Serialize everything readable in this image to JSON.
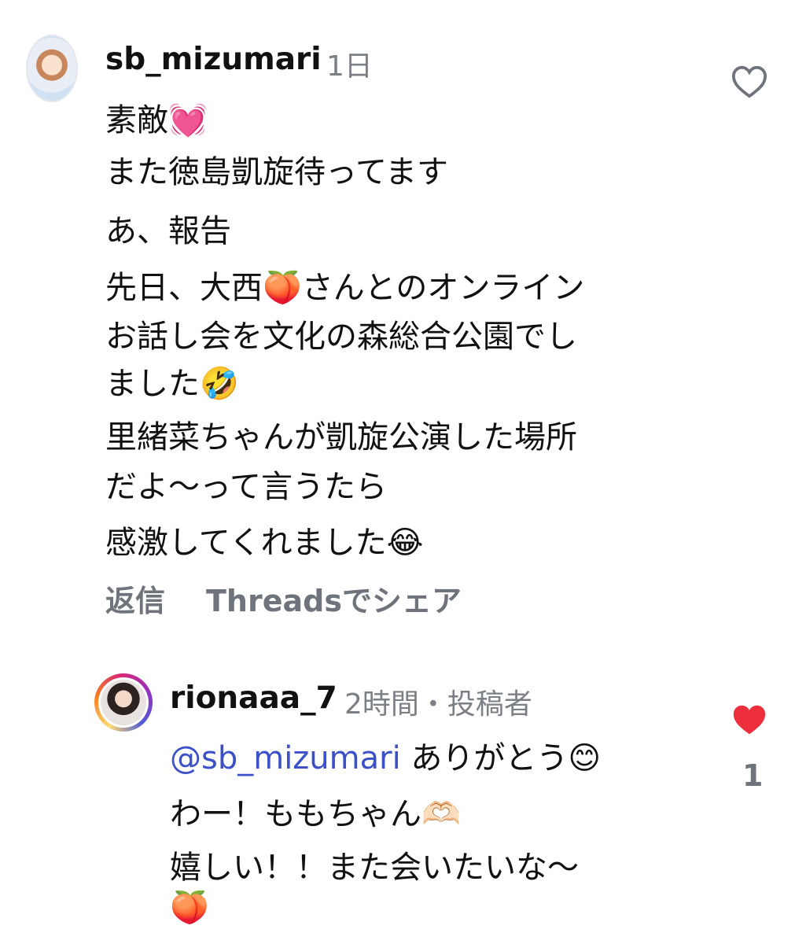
{
  "comment": {
    "username": "sb_mizumari",
    "time": "1日",
    "lines": [
      "素敵💓",
      "また徳島凱旋待ってます",
      "あ、報告",
      "先日、大西🍑さんとのオンライン",
      "お話し会を文化の森総合公園でし",
      "ました🤣",
      "里緒菜ちゃんが凱旋公演した場所",
      "だよ〜って言うたら",
      "感激してくれました😂"
    ],
    "actions": {
      "reply": "返信",
      "share": "Threadsでシェア"
    }
  },
  "reply": {
    "username": "rionaaa_7",
    "meta": "2時間・投稿者",
    "mention": "@sb_mizumari",
    "line1_rest": "ありがとう😊",
    "lines": [
      "わー！ももちゃん🫶🏻",
      "嬉しい！！また会いたいな〜",
      "🍑"
    ],
    "like_count": "1"
  },
  "colors": {
    "heart_liked": "#ed2f3d",
    "mention": "#3b50c9",
    "muted": "#6f747c"
  }
}
